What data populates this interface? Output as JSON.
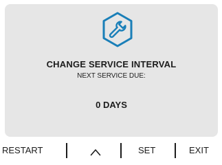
{
  "screen": {
    "icon": "wrench-icon",
    "title": "CHANGE SERVICE INTERVAL",
    "subtitle": "NEXT SERVICE DUE:",
    "value": "0 DAYS"
  },
  "softkeys": {
    "restart": "RESTART",
    "up": "chevron-up-icon",
    "set": "SET",
    "exit": "EXIT"
  },
  "colors": {
    "accent": "#1a7fb8",
    "screen_bg": "#e6e6e6",
    "text": "#1c1c1c"
  }
}
